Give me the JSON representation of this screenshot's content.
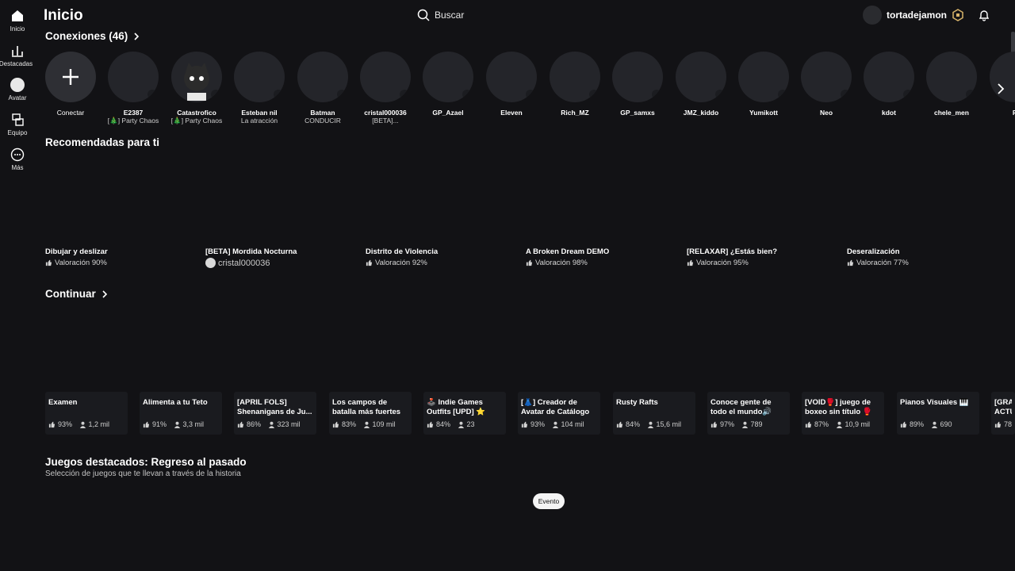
{
  "header": {
    "title": "Inicio",
    "search_label": "Buscar",
    "username": "tortadejamon"
  },
  "rail": [
    {
      "label": "Inicio",
      "icon": "home-icon"
    },
    {
      "label": "Destacadas",
      "icon": "chart-icon"
    },
    {
      "label": "Avatar",
      "icon": "avatar-icon"
    },
    {
      "label": "Equipo",
      "icon": "team-icon"
    },
    {
      "label": "Más",
      "icon": "more-icon"
    }
  ],
  "connections": {
    "title": "Conexiones (46)",
    "add_label": "Conectar",
    "friends": [
      {
        "name": "E2387",
        "status": "[🎄] Party Chaos"
      },
      {
        "name": "Catastrofico",
        "status": "[🎄] Party Chaos"
      },
      {
        "name": "Esteban nil",
        "status": "La atracción"
      },
      {
        "name": "Batman",
        "status": "CONDUCIR"
      },
      {
        "name": "cristal000036",
        "status": "[BETA]..."
      },
      {
        "name": "GP_Azael",
        "status": ""
      },
      {
        "name": "Eleven",
        "status": ""
      },
      {
        "name": "Rich_MZ",
        "status": ""
      },
      {
        "name": "GP_samxs",
        "status": ""
      },
      {
        "name": "JMZ_kiddo",
        "status": ""
      },
      {
        "name": "Yumikott",
        "status": ""
      },
      {
        "name": "Neo",
        "status": ""
      },
      {
        "name": "kdot",
        "status": ""
      },
      {
        "name": "chele_men",
        "status": ""
      },
      {
        "name": "R",
        "status": ""
      }
    ]
  },
  "recommended": {
    "title": "Recomendadas para ti",
    "items": [
      {
        "title": "Dibujar y deslizar",
        "rating": "Valoración 90%"
      },
      {
        "title": "[BETA] Mordida Nocturna",
        "owner": "cristal000036"
      },
      {
        "title": "Distrito de Violencia",
        "rating": "Valoración 92%"
      },
      {
        "title": "A Broken Dream DEMO",
        "rating": "Valoración 98%"
      },
      {
        "title": "[RELAXAR] ¿Estás bien?",
        "rating": "Valoración 95%"
      },
      {
        "title": "Deseralización",
        "rating": "Valoración 77%"
      }
    ]
  },
  "continue": {
    "title": "Continuar",
    "items": [
      {
        "title": "Examen",
        "rating": "93%",
        "players": "1,2 mil"
      },
      {
        "title": "Alimenta a tu Teto",
        "rating": "91%",
        "players": "3,3 mil"
      },
      {
        "title": "[APRIL FOLS] Shenanigans de Ju...",
        "rating": "86%",
        "players": "323 mil"
      },
      {
        "title": "Los campos de batalla más fuertes",
        "rating": "83%",
        "players": "109 mil"
      },
      {
        "title": "🕹️ Indie Games Outfits [UPD] ⭐",
        "rating": "84%",
        "players": "23"
      },
      {
        "title": "[👗] Creador de Avatar de Catálogo",
        "rating": "93%",
        "players": "104 mil"
      },
      {
        "title": "Rusty Rafts",
        "rating": "84%",
        "players": "15,6 mil"
      },
      {
        "title": "Conoce gente de todo el mundo🔊",
        "rating": "97%",
        "players": "789"
      },
      {
        "title": "[VOID🥊] juego de boxeo sin título 🥊",
        "rating": "87%",
        "players": "10,9 mil"
      },
      {
        "title": "Pianos Visuales 🎹",
        "rating": "89%",
        "players": "690"
      },
      {
        "title": "[GRA ACTU",
        "rating": "78",
        "players": ""
      }
    ]
  },
  "featured": {
    "title": "Juegos destacados: Regreso al pasado",
    "subtitle": "Selección de juegos que te llevan a través de la historia",
    "pill": "Evento"
  }
}
